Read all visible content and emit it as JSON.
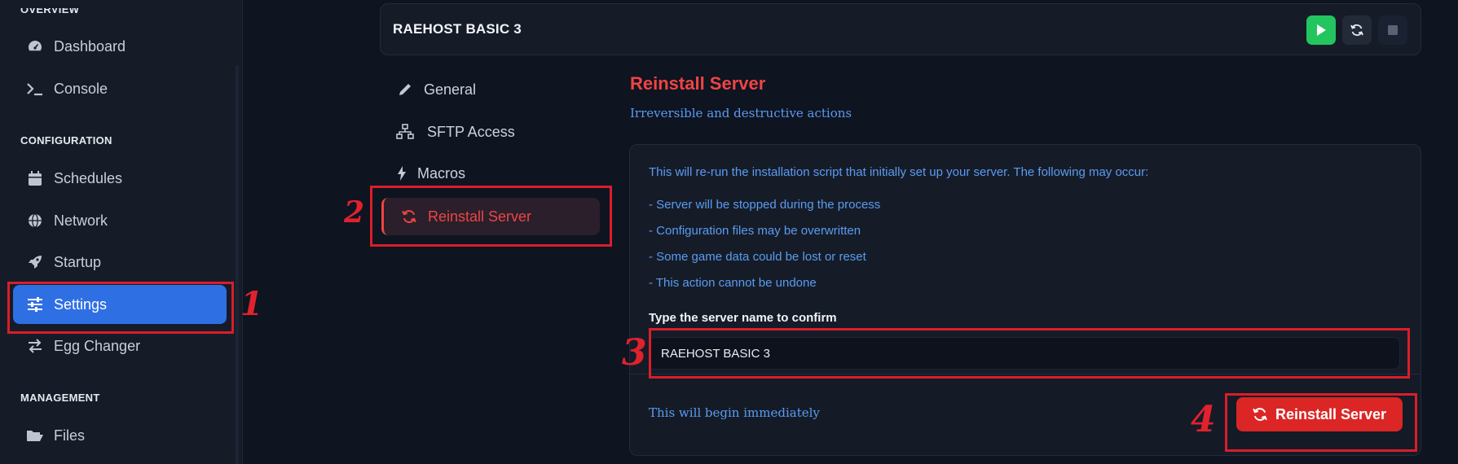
{
  "sidebar": {
    "overview_label": "OVERVIEW",
    "configuration_label": "CONFIGURATION",
    "management_label": "MANAGEMENT",
    "items": {
      "dashboard": "Dashboard",
      "console": "Console",
      "schedules": "Schedules",
      "network": "Network",
      "startup": "Startup",
      "settings": "Settings",
      "egg_changer": "Egg Changer",
      "files": "Files"
    },
    "active": "settings"
  },
  "header": {
    "server_name": "RAEHOST BASIC 3",
    "buttons": [
      "start",
      "restart",
      "stop"
    ]
  },
  "settings_nav": {
    "general": "General",
    "sftp": "SFTP Access",
    "macros": "Macros",
    "reinstall": "Reinstall Server",
    "active": "reinstall"
  },
  "main": {
    "title": "Reinstall Server",
    "subtitle": "Irreversible and destructive actions",
    "intro": "This will re-run the installation script that initially set up your server. The following may occur:",
    "effects": [
      "- Server will be stopped during the process",
      "- Configuration files may be overwritten",
      "- Some game data could be lost or reset",
      "- This action cannot be undone"
    ],
    "confirm_label": "Type the server name to confirm",
    "confirm_value": "RAEHOST BASIC 3",
    "footer_note": "This will begin immediately",
    "button_label": "Reinstall Server"
  },
  "annotations": {
    "numbers": [
      "1",
      "2",
      "3",
      "4"
    ],
    "color": "#d91e2a"
  },
  "colors": {
    "accent_blue": "#2f6fe4",
    "danger": "#ef4444",
    "start_green": "#22c55e",
    "info_text": "#5b9bf0"
  }
}
